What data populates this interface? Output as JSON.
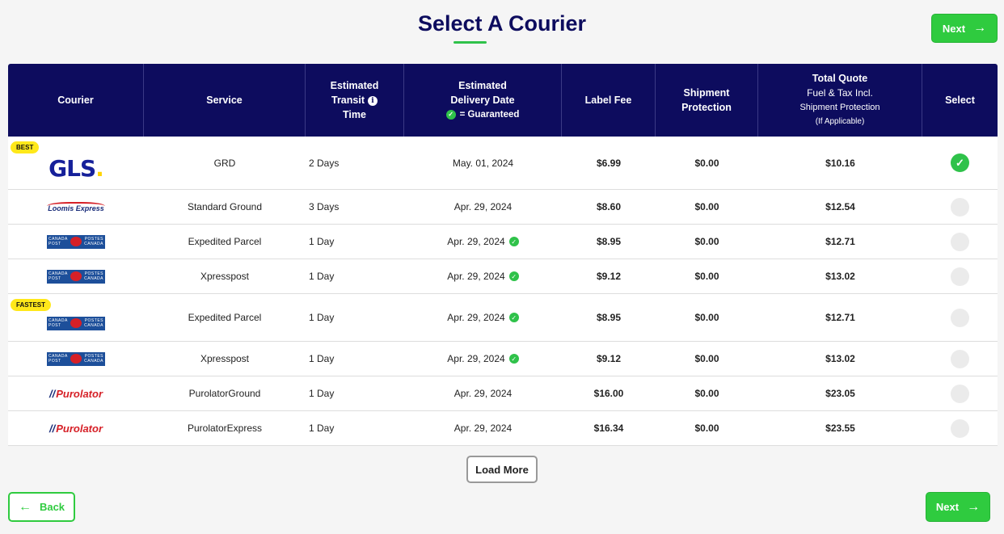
{
  "page": {
    "title": "Select A Courier"
  },
  "buttons": {
    "next": "Next",
    "back": "Back",
    "load_more": "Load More"
  },
  "header": {
    "courier": "Courier",
    "service": "Service",
    "transit_l1": "Estimated",
    "transit_l2": "Transit",
    "transit_l3": "Time",
    "delivery_l1": "Estimated",
    "delivery_l2": "Delivery Date",
    "delivery_guaranteed": "= Guaranteed",
    "label_fee": "Label Fee",
    "protection_l1": "Shipment",
    "protection_l2": "Protection",
    "total_l1": "Total Quote",
    "total_l2": "Fuel & Tax Incl.",
    "total_l3": "Shipment Protection",
    "total_l4": "(If Applicable)",
    "select": "Select"
  },
  "logos": {
    "gls": "GLS",
    "loomis": "Loomis Express",
    "cp_left_top": "CANADA",
    "cp_left_bottom": "POST",
    "cp_right_top": "POSTES",
    "cp_right_bottom": "CANADA",
    "purolator": "Purolator"
  },
  "rows": [
    {
      "badge": "BEST",
      "courier": "gls",
      "service": "GRD",
      "transit": "2 Days",
      "delivery": "May. 01, 2024",
      "guaranteed": false,
      "label_fee": "$6.99",
      "protection": "$0.00",
      "total": "$10.16",
      "selected": true
    },
    {
      "badge": "",
      "courier": "loomis",
      "service": "Standard Ground",
      "transit": "3 Days",
      "delivery": "Apr. 29, 2024",
      "guaranteed": false,
      "label_fee": "$8.60",
      "protection": "$0.00",
      "total": "$12.54",
      "selected": false
    },
    {
      "badge": "",
      "courier": "canada-post",
      "service": "Expedited Parcel",
      "transit": "1 Day",
      "delivery": "Apr. 29, 2024",
      "guaranteed": true,
      "label_fee": "$8.95",
      "protection": "$0.00",
      "total": "$12.71",
      "selected": false
    },
    {
      "badge": "",
      "courier": "canada-post",
      "service": "Xpresspost",
      "transit": "1 Day",
      "delivery": "Apr. 29, 2024",
      "guaranteed": true,
      "label_fee": "$9.12",
      "protection": "$0.00",
      "total": "$13.02",
      "selected": false
    },
    {
      "badge": "FASTEST",
      "courier": "canada-post",
      "service": "Expedited Parcel",
      "transit": "1 Day",
      "delivery": "Apr. 29, 2024",
      "guaranteed": true,
      "label_fee": "$8.95",
      "protection": "$0.00",
      "total": "$12.71",
      "selected": false
    },
    {
      "badge": "",
      "courier": "canada-post",
      "service": "Xpresspost",
      "transit": "1 Day",
      "delivery": "Apr. 29, 2024",
      "guaranteed": true,
      "label_fee": "$9.12",
      "protection": "$0.00",
      "total": "$13.02",
      "selected": false
    },
    {
      "badge": "",
      "courier": "purolator",
      "service": "PurolatorGround",
      "transit": "1 Day",
      "delivery": "Apr. 29, 2024",
      "guaranteed": false,
      "label_fee": "$16.00",
      "protection": "$0.00",
      "total": "$23.05",
      "selected": false
    },
    {
      "badge": "",
      "courier": "purolator",
      "service": "PurolatorExpress",
      "transit": "1 Day",
      "delivery": "Apr. 29, 2024",
      "guaranteed": false,
      "label_fee": "$16.34",
      "protection": "$0.00",
      "total": "$23.55",
      "selected": false
    }
  ],
  "colors": {
    "navy": "#0d0c5e",
    "green": "#2fcb3f",
    "badge_yellow": "#ffe81a"
  }
}
